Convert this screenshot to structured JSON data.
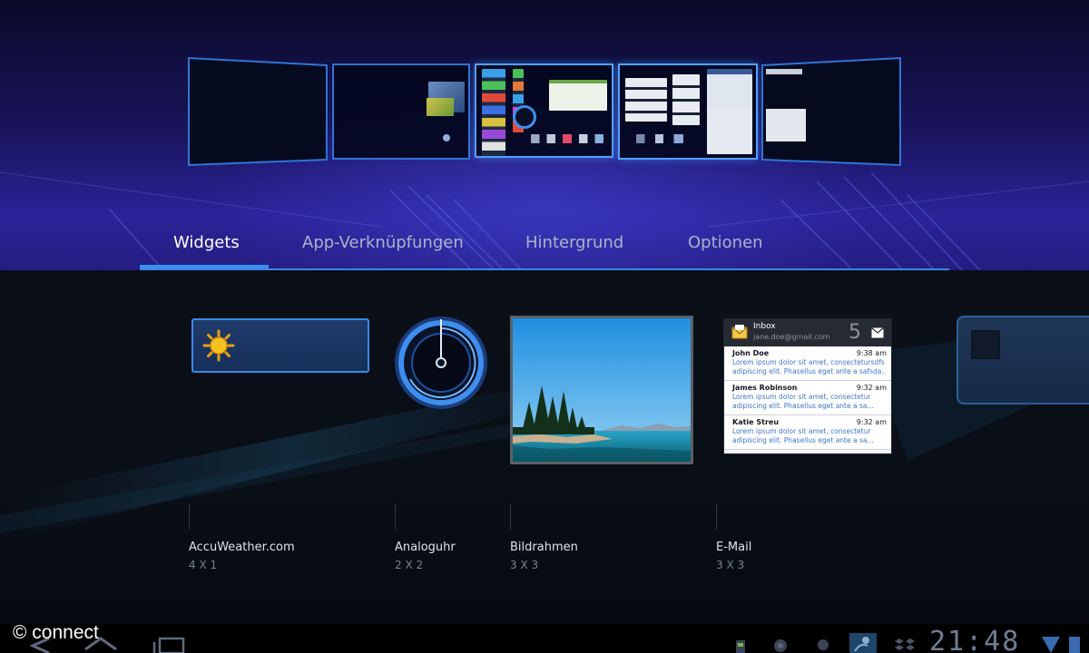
{
  "tabs": [
    {
      "label": "Widgets",
      "selected": true
    },
    {
      "label": "App-Verknüpfungen",
      "selected": false
    },
    {
      "label": "Hintergrund",
      "selected": false
    },
    {
      "label": "Optionen",
      "selected": false
    }
  ],
  "widgets": [
    {
      "name": "AccuWeather.com",
      "size": "4 X 1"
    },
    {
      "name": "Analoguhr",
      "size": "2 X 2"
    },
    {
      "name": "Bildrahmen",
      "size": "3 X 3"
    },
    {
      "name": "E-Mail",
      "size": "3 X 3"
    }
  ],
  "email_widget": {
    "title": "Inbox",
    "account": "jane.doe@gmail.com",
    "unread_count": "5",
    "messages": [
      {
        "from": "John Doe",
        "time": "9:38 am",
        "line1": "Lorem ipsum dolor sit amet, consectetursdfs",
        "line2": "adipiscing elit. Phasellus eget ante a safsda..."
      },
      {
        "from": "James Robinson",
        "time": "9:32 am",
        "line1": "Lorem ipsum dolor sit amet, consectetur",
        "line2": "adipiscing elit. Phasellus eget ante a sa..."
      },
      {
        "from": "Katie Streu",
        "time": "9:32 am",
        "line1": "Lorem ipsum dolor sit amet, consectetur",
        "line2": "adipiscing elit. Phasellus eget ante a sa..."
      }
    ]
  },
  "status_bar": {
    "clock": "21:48"
  },
  "watermark": "© connect",
  "colors": {
    "accent": "#3e8ef0",
    "tab_text": "#a8b4c8",
    "tab_text_selected": "#ffffff",
    "email_body": "#3d76c6"
  },
  "icons": {
    "weather": "sun-icon",
    "clock": "analog-clock-icon",
    "inbox": "envelope-icon",
    "back": "back-icon",
    "home": "home-icon",
    "recent": "recent-apps-icon",
    "wifi": "wifi-icon",
    "battery": "battery-icon"
  }
}
